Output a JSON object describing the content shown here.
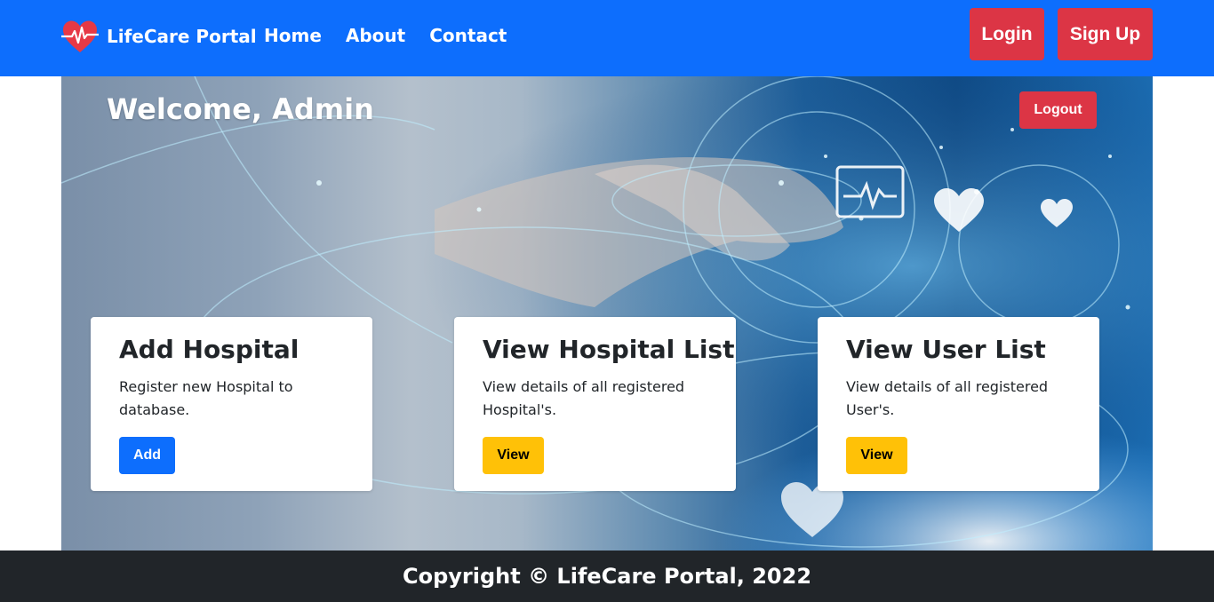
{
  "brand": {
    "name": "LifeCare Portal",
    "icon": "heart-pulse-icon"
  },
  "nav": {
    "links": [
      "Home",
      "About",
      "Contact"
    ],
    "login_label": "Login",
    "signup_label": "Sign Up"
  },
  "hero": {
    "welcome": "Welcome, Admin",
    "logout_label": "Logout"
  },
  "cards": [
    {
      "title": "Add Hospital",
      "text": "Register new Hospital to database.",
      "button": "Add"
    },
    {
      "title": "View Hospital List",
      "text": "View details of all registered Hospital's.",
      "button": "View"
    },
    {
      "title": "View User List",
      "text": "View details of all registered User's.",
      "button": "View"
    }
  ],
  "footer": {
    "text": "Copyright © LifeCare Portal, 2022"
  },
  "colors": {
    "primary": "#0d6efd",
    "danger": "#dc3545",
    "warning": "#ffc107",
    "dark": "#212529"
  }
}
